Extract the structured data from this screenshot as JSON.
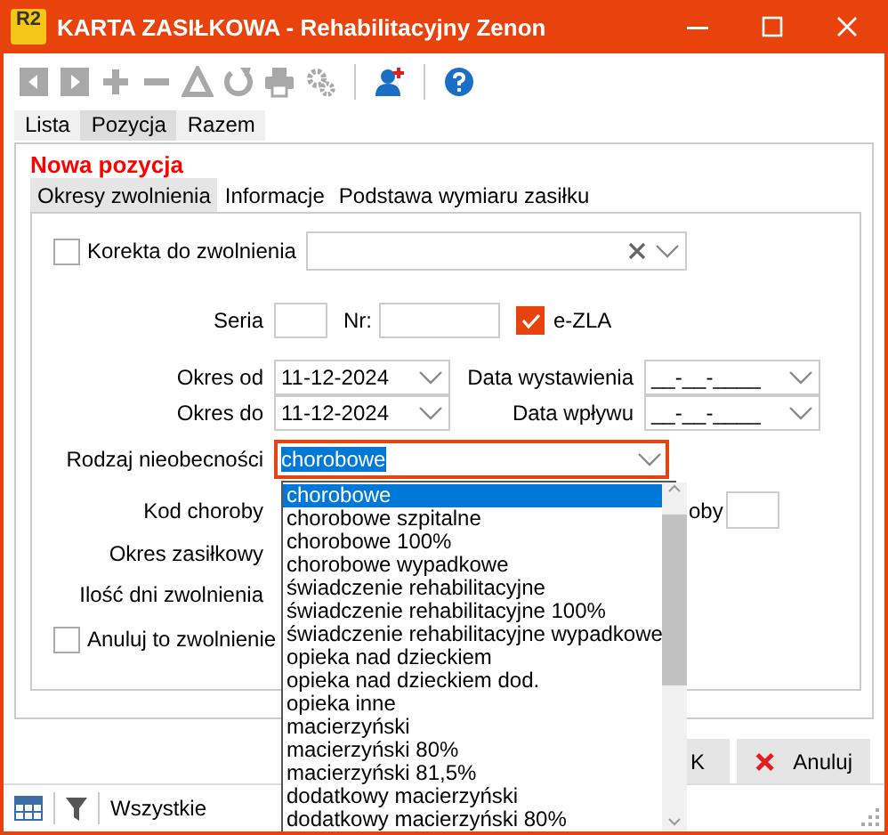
{
  "window": {
    "title": "KARTA ZASIŁKOWA - Rehabilitacyjny Zenon",
    "logo_text": "R2"
  },
  "toolbar": [
    {
      "kind": "back",
      "disabled": true
    },
    {
      "kind": "forward",
      "disabled": true
    },
    {
      "kind": "add",
      "disabled": true
    },
    {
      "kind": "remove",
      "disabled": true
    },
    {
      "kind": "triangle",
      "disabled": true
    },
    {
      "kind": "refresh",
      "disabled": true
    },
    {
      "kind": "print",
      "disabled": true
    },
    {
      "kind": "gear",
      "disabled": true
    },
    {
      "kind": "separator"
    },
    {
      "kind": "person",
      "disabled": false
    },
    {
      "kind": "separator"
    },
    {
      "kind": "help",
      "disabled": false
    }
  ],
  "tabs": [
    {
      "label": "Lista",
      "selected": false
    },
    {
      "label": "Pozycja",
      "selected": true
    },
    {
      "label": "Razem",
      "selected": false
    }
  ],
  "panel_title": "Nowa pozycja",
  "inner_tabs": [
    {
      "label": "Okresy zwolnienia",
      "selected": true
    },
    {
      "label": "Informacje",
      "selected": false
    },
    {
      "label": "Podstawa wymiaru zasiłku",
      "selected": false
    }
  ],
  "form": {
    "korekta": {
      "label": "Korekta do zwolnienia",
      "checked": false
    },
    "seria_label": "Seria",
    "nr_label": "Nr:",
    "ezla": {
      "label": "e-ZLA",
      "checked": true
    },
    "okres_od": {
      "label": "Okres od",
      "value": "11-12-2024"
    },
    "okres_do": {
      "label": "Okres do",
      "value": "11-12-2024"
    },
    "data_wystawienia": {
      "label": "Data wystawienia",
      "value": "__-__-____"
    },
    "data_wplywu": {
      "label": "Data wpływu",
      "value": "__-__-____"
    },
    "rodzaj": {
      "label": "Rodzaj nieobecności",
      "value": "chorobowe"
    },
    "kod_choroby_label": "Kod choroby",
    "covered_label": "oby",
    "okres_zasilkowy_label": "Okres zasiłkowy",
    "ilosc_dni_label": "Ilość dni zwolnienia",
    "anuluj": {
      "label": "Anuluj to zwolnienie",
      "checked": false
    }
  },
  "dropdown": {
    "items": [
      {
        "label": "chorobowe",
        "selected": true
      },
      {
        "label": "chorobowe szpitalne",
        "selected": false
      },
      {
        "label": "chorobowe 100%",
        "selected": false
      },
      {
        "label": "chorobowe wypadkowe",
        "selected": false
      },
      {
        "label": "świadczenie rehabilitacyjne",
        "selected": false
      },
      {
        "label": "świadczenie rehabilitacyjne 100%",
        "selected": false
      },
      {
        "label": "świadczenie rehabilitacyjne wypadkowe",
        "selected": false
      },
      {
        "label": "opieka nad dzieckiem",
        "selected": false
      },
      {
        "label": "opieka nad dzieckiem dod.",
        "selected": false
      },
      {
        "label": "opieka inne",
        "selected": false
      },
      {
        "label": "macierzyński",
        "selected": false
      },
      {
        "label": "macierzyński 80%",
        "selected": false
      },
      {
        "label": "macierzyński 81,5%",
        "selected": false
      },
      {
        "label": "dodatkowy macierzyński",
        "selected": false
      },
      {
        "label": "dodatkowy macierzyński 80%",
        "selected": false
      }
    ]
  },
  "buttons": [
    {
      "kind": "ok",
      "label": "K"
    },
    {
      "kind": "cancel",
      "label": "Anuluj"
    }
  ],
  "status_bar": {
    "filter_label": "Wszystkie"
  }
}
